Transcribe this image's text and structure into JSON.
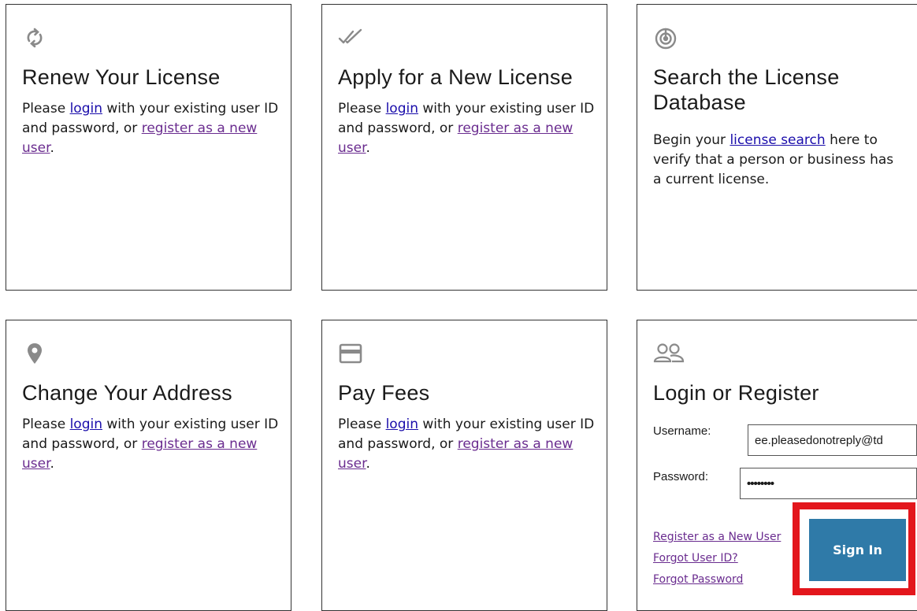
{
  "cards": {
    "renew": {
      "title": "Renew Your License",
      "text_before": "Please ",
      "login_link": "login",
      "text_middle": " with your existing user ID and password, or ",
      "register_link": "register as a new user",
      "text_after": ".",
      "icon": "refresh-icon"
    },
    "apply": {
      "title": "Apply for a New License",
      "text_before": "Please ",
      "login_link": "login",
      "text_middle": " with your existing user ID and password, or ",
      "register_link": "register as a new user",
      "text_after": ".",
      "icon": "double-check-icon"
    },
    "search": {
      "title": "Search the License Database",
      "text_before": "Begin your ",
      "search_link": "license search",
      "text_after": " here to verify that a person or business has a current license.",
      "icon": "radar-icon"
    },
    "address": {
      "title": "Change Your Address",
      "text_before": "Please ",
      "login_link": "login",
      "text_middle": " with your existing user ID and password, or ",
      "register_link": "register as a new user",
      "text_after": ".",
      "icon": "location-pin-icon"
    },
    "fees": {
      "title": "Pay Fees",
      "text_before": "Please ",
      "login_link": "login",
      "text_middle": " with your existing user ID and password, or ",
      "register_link": "register as a new user",
      "text_after": ".",
      "icon": "credit-card-icon"
    },
    "login": {
      "title": "Login or Register",
      "username_label": "Username:",
      "username_value": "ee.pleasedonotreply@td",
      "password_label": "Password:",
      "password_value": "••••••••",
      "register_link": "Register as a New User",
      "forgot_user_link": "Forgot User ID?",
      "forgot_password_link": "Forgot Password",
      "signin_label": "Sign In",
      "icon": "users-icon"
    }
  },
  "colors": {
    "link_blue": "#1a0dab",
    "link_purple": "#6a2c8f",
    "button_bg": "#2f7aa8",
    "highlight_red": "#e3161c",
    "icon_gray": "#8a8a8a"
  }
}
